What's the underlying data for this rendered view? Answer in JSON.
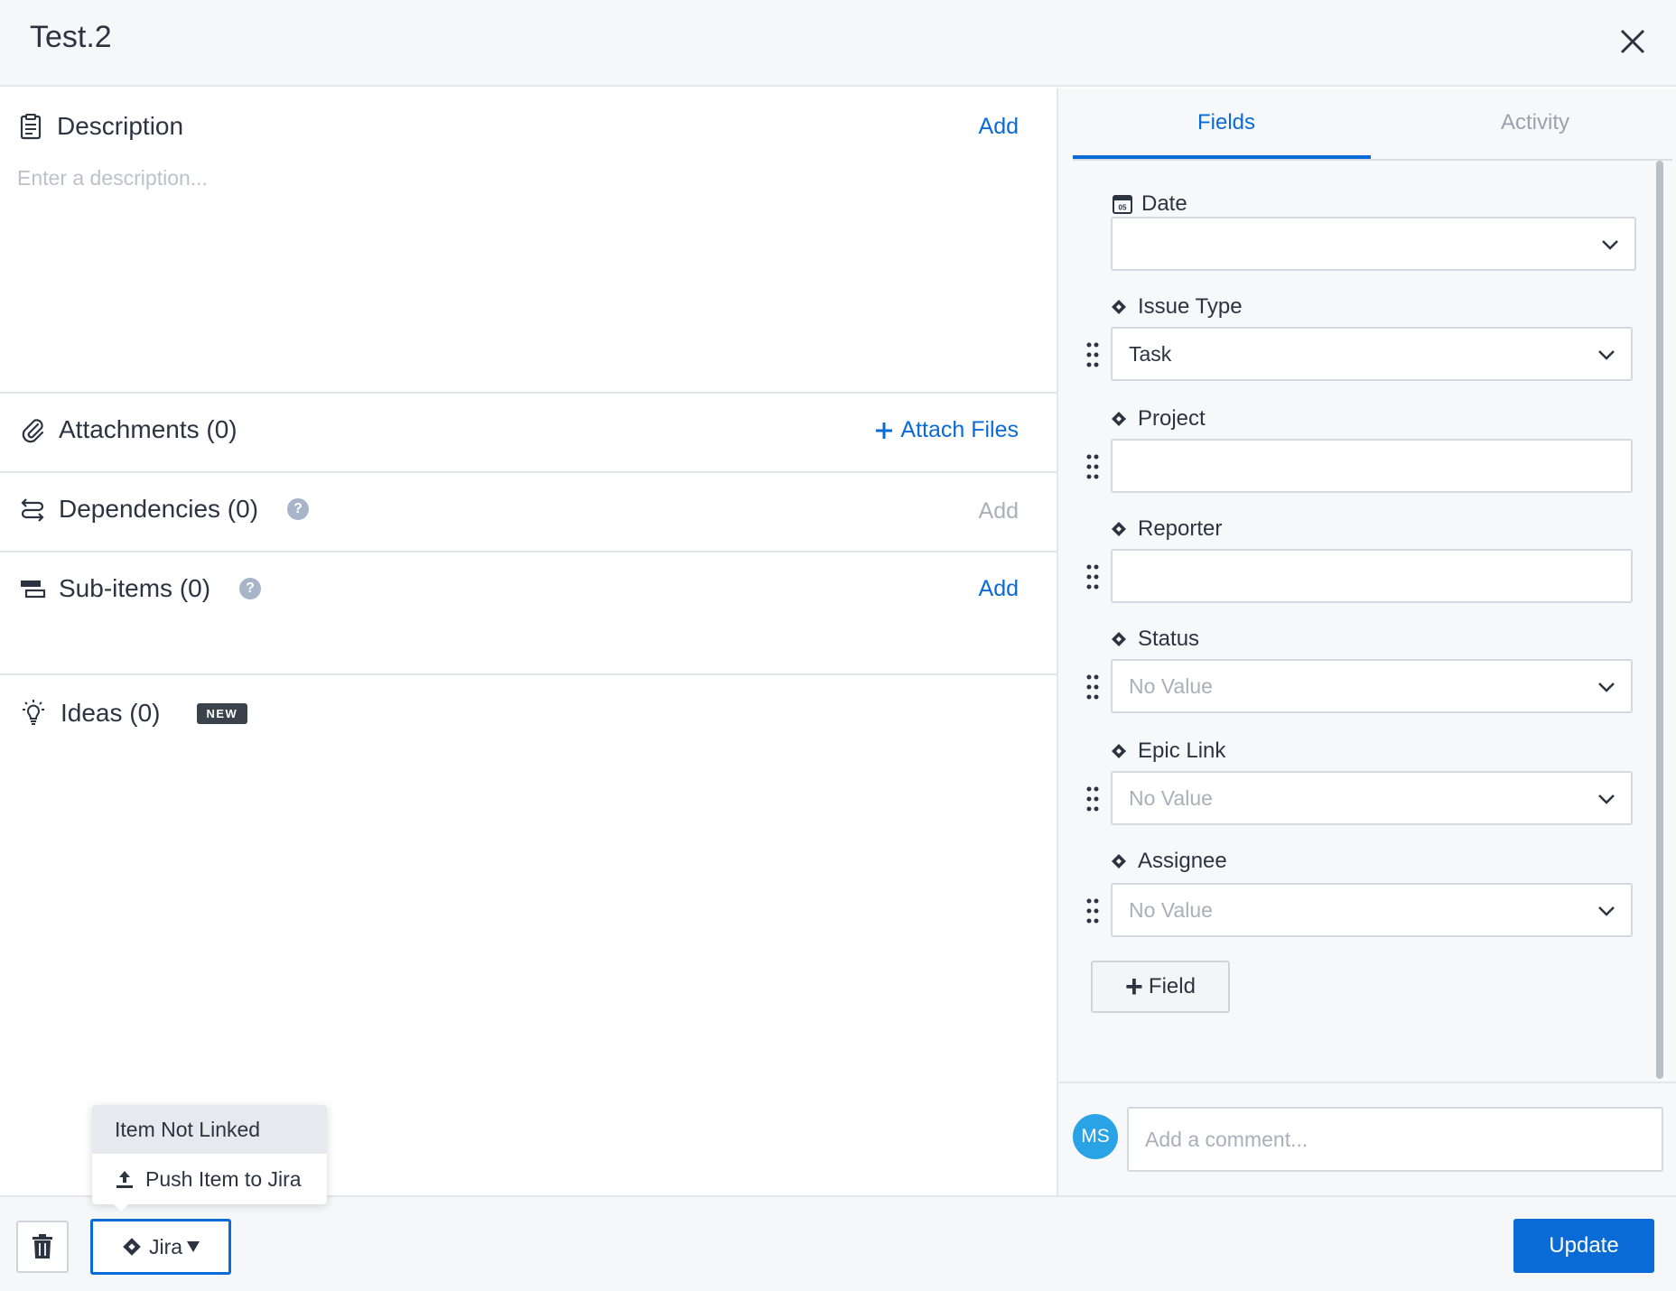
{
  "header": {
    "title": "Test.2"
  },
  "description": {
    "title": "Description",
    "add_label": "Add",
    "placeholder": "Enter a description..."
  },
  "attachments": {
    "title": "Attachments (0)",
    "action_label": "Attach Files"
  },
  "dependencies": {
    "title": "Dependencies (0)",
    "add_label": "Add",
    "help": "?"
  },
  "subitems": {
    "title": "Sub-items (0)",
    "add_label": "Add",
    "help": "?"
  },
  "ideas": {
    "title": "Ideas (0)",
    "badge": "NEW"
  },
  "tabs": {
    "fields": "Fields",
    "activity": "Activity"
  },
  "fields": {
    "date": {
      "label": "Date",
      "value": "",
      "icon_text": "05"
    },
    "issue_type": {
      "label": "Issue Type",
      "value": "Task"
    },
    "project": {
      "label": "Project",
      "value": ""
    },
    "reporter": {
      "label": "Reporter",
      "value": ""
    },
    "status": {
      "label": "Status",
      "value": "No Value"
    },
    "epic_link": {
      "label": "Epic Link",
      "value": "No Value"
    },
    "assignee": {
      "label": "Assignee",
      "value": "No Value"
    }
  },
  "add_field_label": "Field",
  "comment": {
    "avatar_initials": "MS",
    "placeholder": "Add a comment..."
  },
  "footer": {
    "jira_label": "Jira",
    "update_label": "Update"
  },
  "jira_menu": {
    "status_text": "Item Not Linked",
    "push_label": "Push Item to Jira"
  },
  "colors": {
    "accent": "#0a6bd6",
    "avatar": "#2aa3e6",
    "badge": "#3a424c"
  }
}
